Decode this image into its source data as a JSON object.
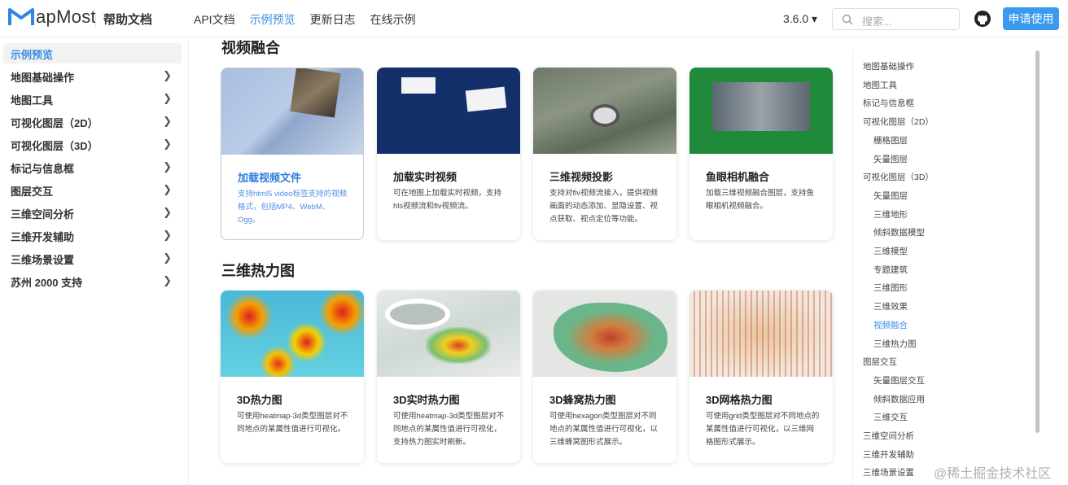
{
  "header": {
    "logo_text": "apMost",
    "subtitle": "帮助文档",
    "nav": [
      {
        "label": "API文档"
      },
      {
        "label": "示例预览"
      },
      {
        "label": "更新日志"
      },
      {
        "label": "在线示例"
      }
    ],
    "version": "3.6.0",
    "search_placeholder": "搜索...",
    "apply_label": "申请使用"
  },
  "sidebar": {
    "items": [
      {
        "label": "示例预览"
      },
      {
        "label": "地图基础操作"
      },
      {
        "label": "地图工具"
      },
      {
        "label": "可视化图层（2D）"
      },
      {
        "label": "可视化图层（3D）"
      },
      {
        "label": "标记与信息框"
      },
      {
        "label": "图层交互"
      },
      {
        "label": "三维空间分析"
      },
      {
        "label": "三维开发辅助"
      },
      {
        "label": "三维场景设置"
      },
      {
        "label": "苏州 2000 支持"
      }
    ]
  },
  "sections": [
    {
      "title": "视频融合",
      "cards": [
        {
          "title": "加载视频文件",
          "desc": "支持html5 video标签支持的视频格式，包括MP4、WebM、Ogg。"
        },
        {
          "title": "加载实时视频",
          "desc": "可在地图上加载实时视频，支持hls视频流和flv视频流。"
        },
        {
          "title": "三维视频投影",
          "desc": "支持对flv视频流接入，提供视频画面的动态添加、显隐设置、视点获取、视点定位等功能。"
        },
        {
          "title": "鱼眼相机融合",
          "desc": "加载三维视频融合图层，支持鱼眼相机视频融合。"
        }
      ]
    },
    {
      "title": "三维热力图",
      "cards": [
        {
          "title": "3D热力图",
          "desc": "可使用heatmap-3d类型图层对不同地点的某属性值进行可视化。"
        },
        {
          "title": "3D实时热力图",
          "desc": "可使用heatmap-3d类型图层对不同地点的某属性值进行可视化，支持热力图实时刷新。"
        },
        {
          "title": "3D蜂窝热力图",
          "desc": "可使用hexagon类型图层对不同地点的某属性值进行可视化，以三维蜂窝图形式展示。"
        },
        {
          "title": "3D网格热力图",
          "desc": "可使用grid类型图层对不同地点的某属性值进行可视化，以三维网格图形式展示。"
        }
      ]
    }
  ],
  "toc": {
    "items": [
      {
        "label": "地图基础操作",
        "level": 1
      },
      {
        "label": "地图工具",
        "level": 1
      },
      {
        "label": "标记与信息框",
        "level": 1
      },
      {
        "label": "可视化图层（2D）",
        "level": 1
      },
      {
        "label": "栅格图层",
        "level": 2
      },
      {
        "label": "矢量图层",
        "level": 2
      },
      {
        "label": "可视化图层（3D）",
        "level": 1
      },
      {
        "label": "矢量图层",
        "level": 2
      },
      {
        "label": "三维地形",
        "level": 2
      },
      {
        "label": "倾斜数据模型",
        "level": 2
      },
      {
        "label": "三维模型",
        "level": 2
      },
      {
        "label": "专题建筑",
        "level": 2
      },
      {
        "label": "三维图形",
        "level": 2
      },
      {
        "label": "三维效果",
        "level": 2
      },
      {
        "label": "视频融合",
        "level": 2,
        "active": true
      },
      {
        "label": "三维热力图",
        "level": 2
      },
      {
        "label": "图层交互",
        "level": 1
      },
      {
        "label": "矢量图层交互",
        "level": 2
      },
      {
        "label": "倾斜数据应用",
        "level": 2
      },
      {
        "label": "三维交互",
        "level": 2
      },
      {
        "label": "三维空间分析",
        "level": 1
      },
      {
        "label": "三维开发辅助",
        "level": 1
      },
      {
        "label": "三维场景设置",
        "level": 1
      }
    ]
  },
  "watermark": "@稀土掘金技术社区"
}
